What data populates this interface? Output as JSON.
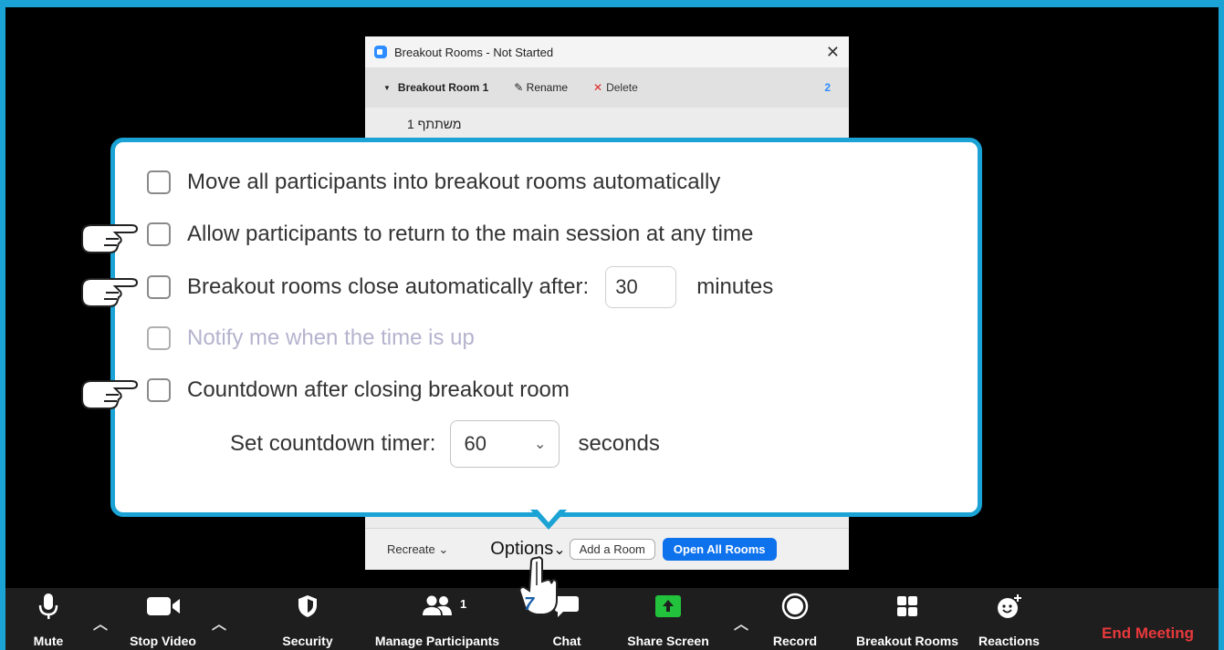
{
  "breakout_window": {
    "title": "Breakout Rooms - Not Started",
    "close_label": "✕",
    "room": {
      "name": "Breakout Room 1",
      "rename_label": "Rename",
      "delete_label": "Delete",
      "participant_count": "2",
      "participants": [
        "משתתף 1"
      ]
    },
    "footer": {
      "recreate_label": "Recreate",
      "options_label": "Options",
      "add_room_label": "Add a Room",
      "open_all_label": "Open All Rooms"
    }
  },
  "options_popup": {
    "opt_move": "Move all participants into breakout rooms automatically",
    "opt_return": "Allow participants to return to the main session at any time",
    "opt_close_prefix": "Breakout rooms close automatically after:",
    "opt_close_minutes_value": "30",
    "opt_close_suffix": "minutes",
    "opt_notify": "Notify me when the time is up",
    "opt_countdown": "Countdown after closing breakout room",
    "countdown_label": "Set countdown timer:",
    "countdown_value": "60",
    "countdown_suffix": "seconds"
  },
  "toolbar": {
    "mute": "Mute",
    "stop_video": "Stop Video",
    "security": "Security",
    "manage_participants": "Manage Participants",
    "participants_count": "1",
    "chat": "Chat",
    "share_screen": "Share Screen",
    "record": "Record",
    "breakout_rooms": "Breakout Rooms",
    "reactions": "Reactions",
    "end_meeting": "End Meeting"
  },
  "step_badge": "7",
  "colors": {
    "accent_border": "#1aa3d4",
    "primary_button": "#0e72ed",
    "end_meeting": "#e8393c",
    "share_green": "#23c23d"
  }
}
